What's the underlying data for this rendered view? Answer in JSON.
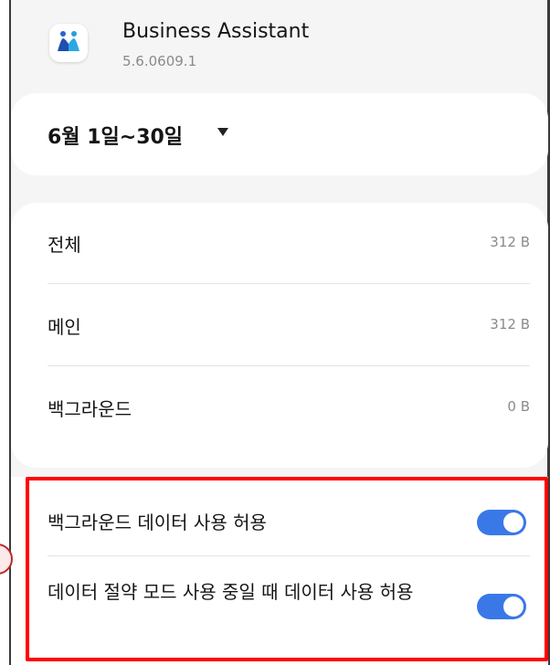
{
  "app": {
    "name": "Business Assistant",
    "version": "5.6.0609.1"
  },
  "period": {
    "label": "6월 1일~30일"
  },
  "usage": {
    "rows": [
      {
        "label": "전체",
        "value": "312 B"
      },
      {
        "label": "메인",
        "value": "312 B"
      },
      {
        "label": "백그라운드",
        "value": "0 B"
      }
    ]
  },
  "settings": {
    "toggles": [
      {
        "label": "백그라운드 데이터 사용 허용",
        "enabled": true
      },
      {
        "label": "데이터 절약 모드 사용 중일 때 데이터 사용 허용",
        "enabled": true
      }
    ]
  },
  "colors": {
    "toggle_on": "#3a78e8",
    "highlight": "#ff0000"
  }
}
